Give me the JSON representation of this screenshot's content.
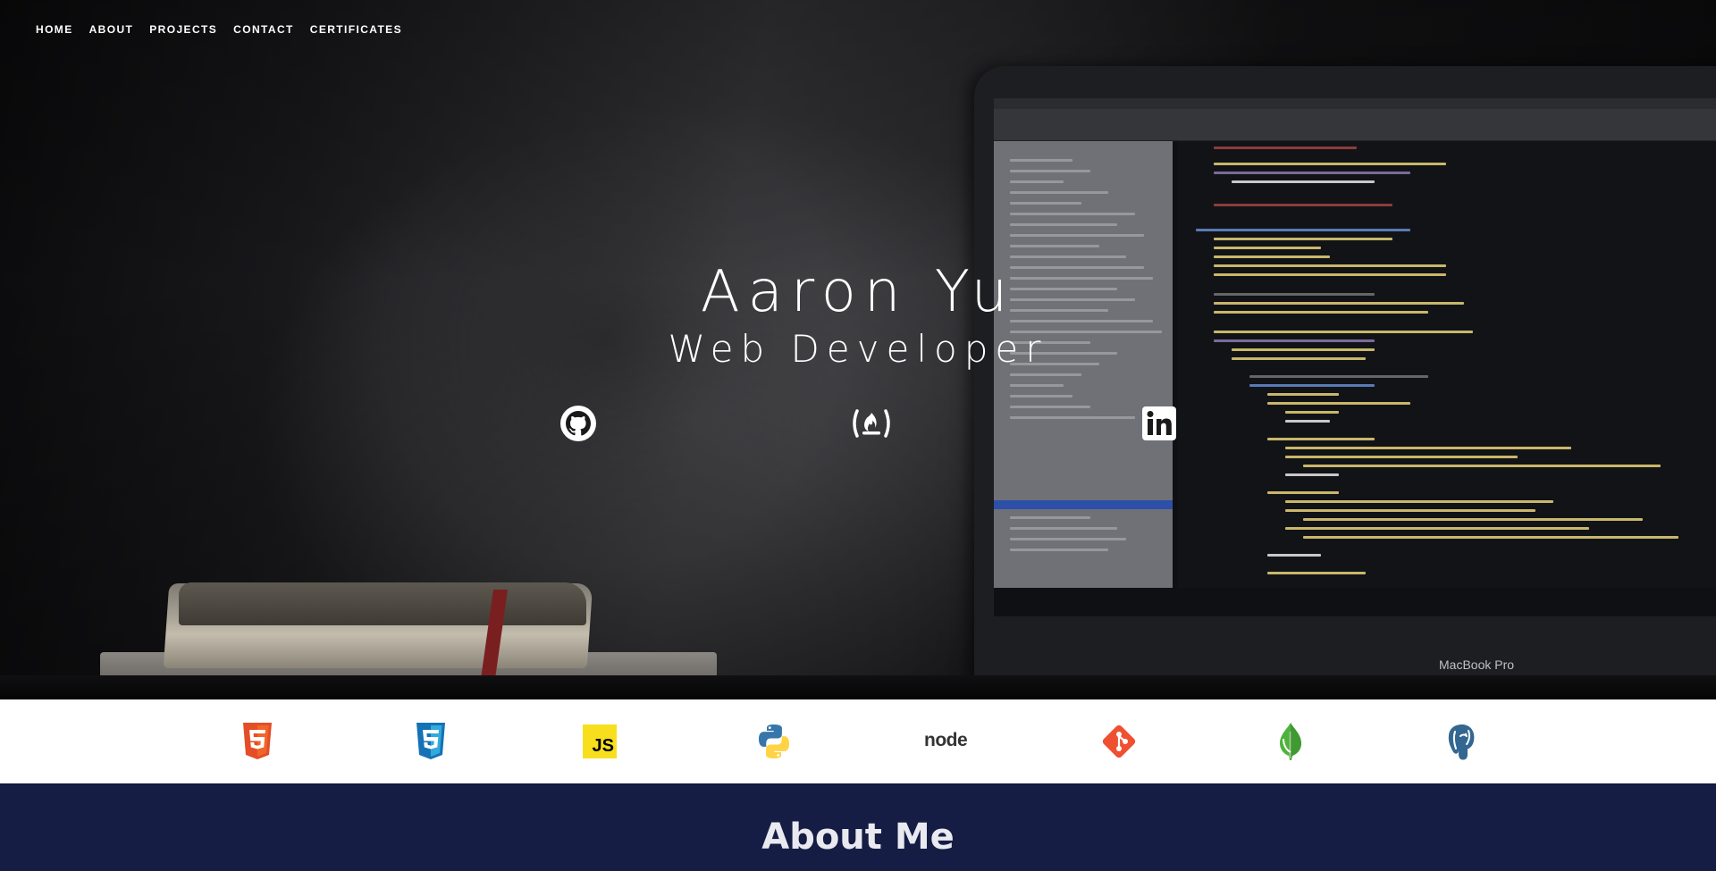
{
  "nav": {
    "items": [
      {
        "label": "HOME"
      },
      {
        "label": "ABOUT"
      },
      {
        "label": "PROJECTS"
      },
      {
        "label": "CONTACT"
      },
      {
        "label": "CERTIFICATES"
      }
    ]
  },
  "hero": {
    "title": "Aaron Yu",
    "subtitle": "Web Developer",
    "laptop_label": "MacBook Pro",
    "social": [
      {
        "icon": "github-icon"
      },
      {
        "icon": "freecodecamp-icon"
      },
      {
        "icon": "linkedin-icon"
      }
    ]
  },
  "tech": [
    {
      "icon": "html5-icon",
      "color": "#e44d26"
    },
    {
      "icon": "css3-icon",
      "color": "#1572b6"
    },
    {
      "icon": "javascript-icon",
      "color": "#f7df1e",
      "text": "JS"
    },
    {
      "icon": "python-icon",
      "color": "#3776ab"
    },
    {
      "icon": "nodejs-icon",
      "color": "#333333",
      "text": "node"
    },
    {
      "icon": "git-icon",
      "color": "#f05032"
    },
    {
      "icon": "mongodb-icon",
      "color": "#4db33d"
    },
    {
      "icon": "postgresql-icon",
      "color": "#336791"
    }
  ],
  "about": {
    "heading": "About Me"
  }
}
